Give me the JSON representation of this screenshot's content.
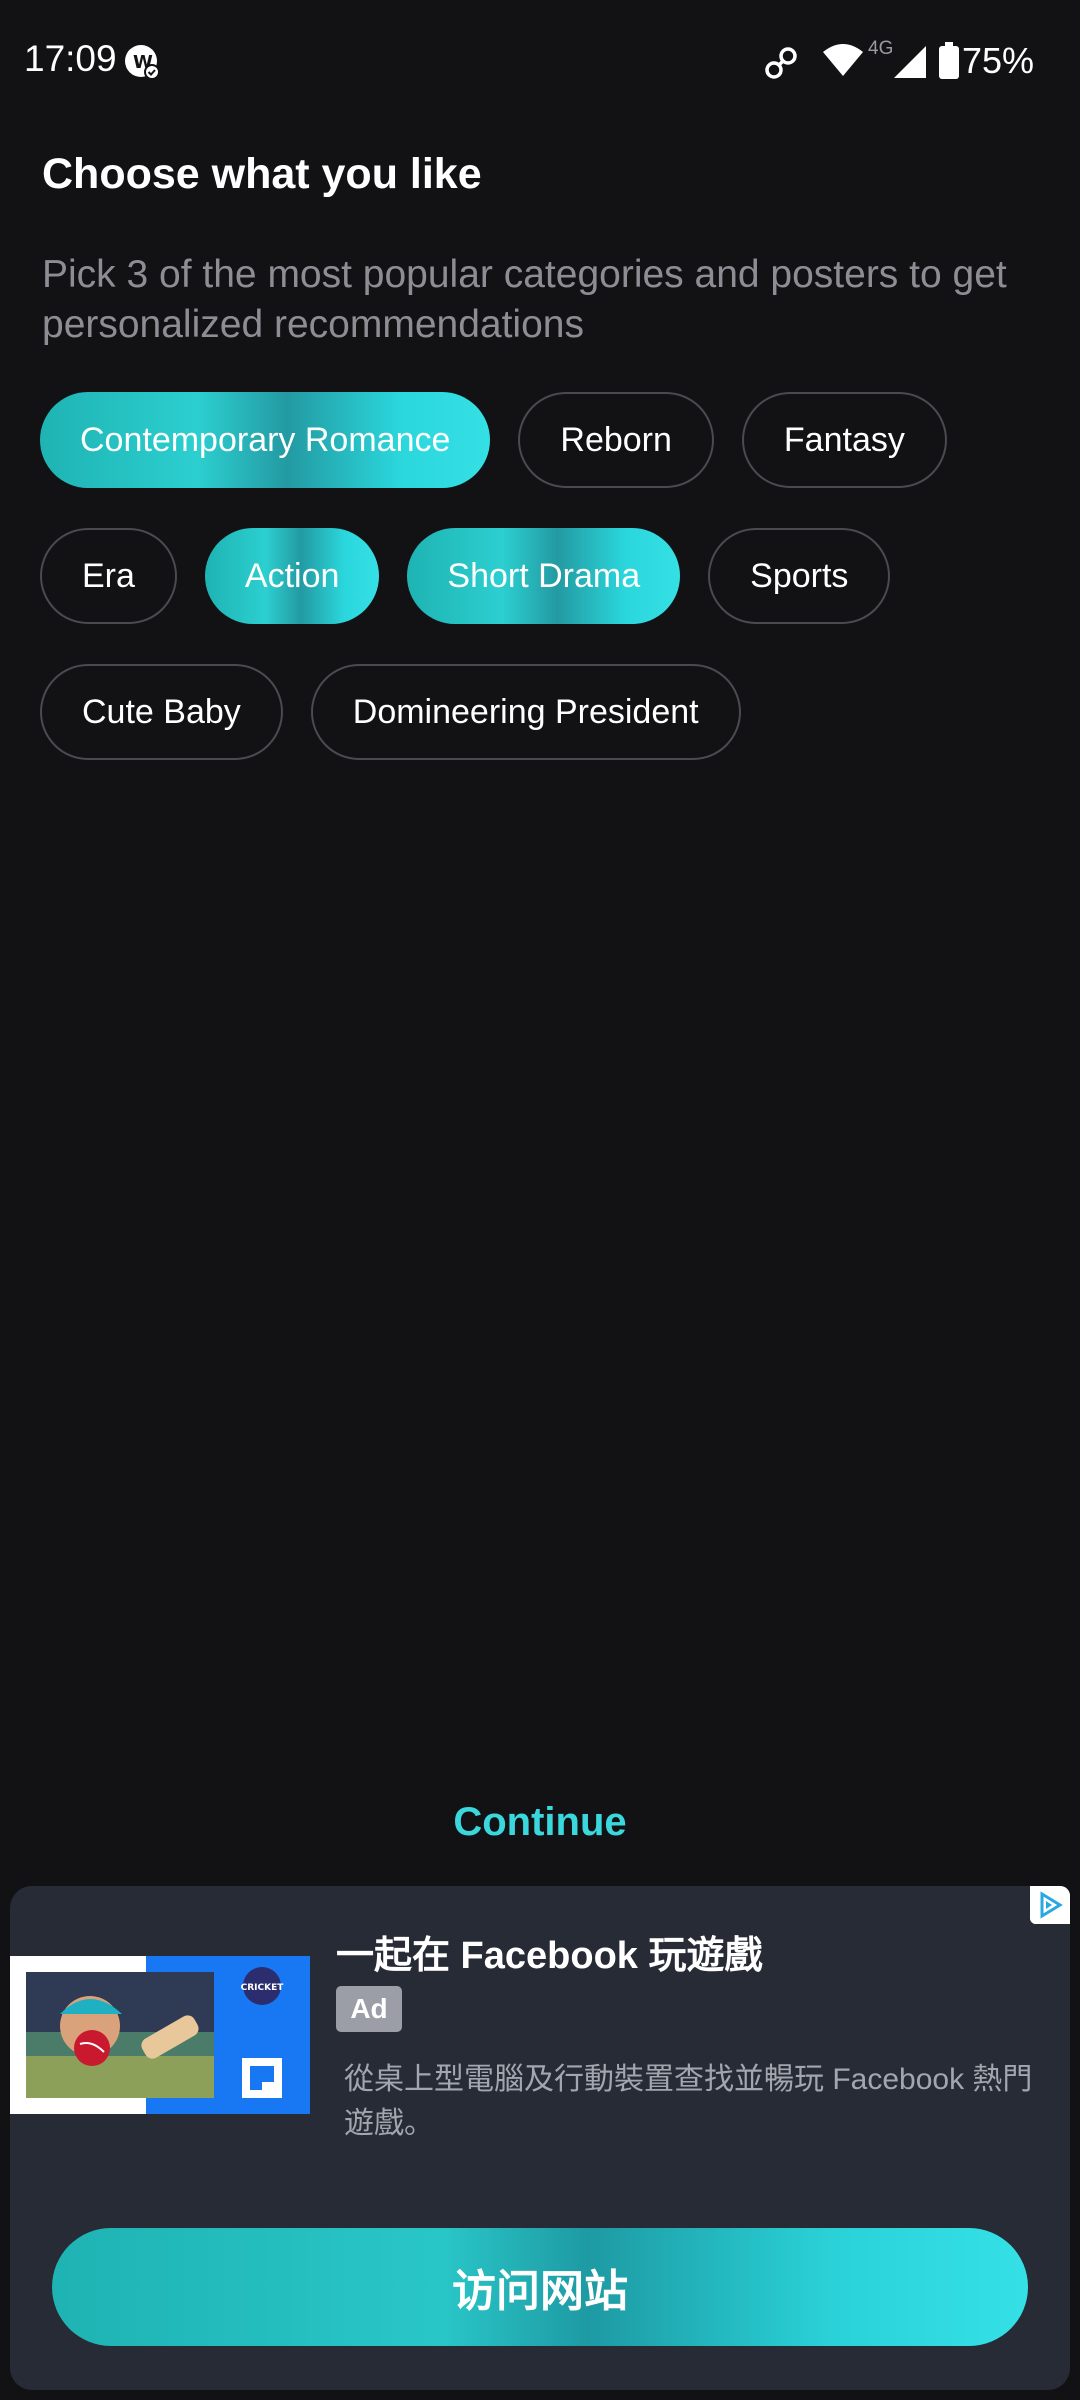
{
  "status_bar": {
    "time": "17:09",
    "network_type": "4G",
    "battery": "75%",
    "icons": [
      "app-notification-icon",
      "link-icon",
      "wifi-icon",
      "signal-icon",
      "battery-icon"
    ]
  },
  "header": {
    "title": "Choose what you like",
    "subtitle": "Pick 3 of the most popular categories and posters to get personalized recommendations"
  },
  "categories": [
    {
      "label": "Contemporary Romance",
      "selected": true
    },
    {
      "label": "Reborn",
      "selected": false
    },
    {
      "label": "Fantasy",
      "selected": false
    },
    {
      "label": "Era",
      "selected": false
    },
    {
      "label": "Action",
      "selected": true
    },
    {
      "label": "Short Drama",
      "selected": true
    },
    {
      "label": "Sports",
      "selected": false
    },
    {
      "label": "Cute Baby",
      "selected": false
    },
    {
      "label": "Domineering President",
      "selected": false
    }
  ],
  "continue_label": "Continue",
  "ad": {
    "headline": "一起在 Facebook 玩遊戲",
    "badge": "Ad",
    "body": "從桌上型電腦及行動裝置查找並暢玩 Facebook 熱門遊戲。",
    "cta": "访问网站",
    "image_badge_text": "CRICKET"
  },
  "colors": {
    "background": "#121215",
    "accent": "#3ad7dc",
    "chip_border": "#4a4a50",
    "ad_background": "#262b36",
    "facebook_blue": "#1877f2"
  }
}
